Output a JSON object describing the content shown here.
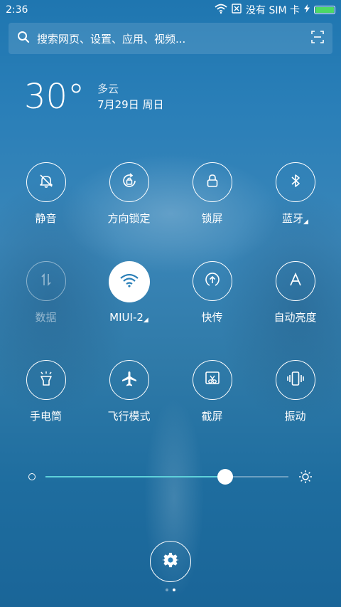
{
  "status_bar": {
    "time": "2:36",
    "carrier": "没有 SIM 卡",
    "battery_level": 1.0,
    "battery_color": "#4cd964"
  },
  "search": {
    "placeholder": "搜索网页、设置、应用、视频...",
    "icon": "search-icon",
    "scan_icon": "scan-icon"
  },
  "weather": {
    "temperature": "30°",
    "condition": "多云",
    "date": "7月29日 周日"
  },
  "toggles": [
    {
      "label": "静音",
      "icon": "bell-off-icon",
      "state": "off"
    },
    {
      "label": "方向锁定",
      "icon": "rotation-lock-icon",
      "state": "off"
    },
    {
      "label": "锁屏",
      "icon": "lock-icon",
      "state": "off"
    },
    {
      "label": "蓝牙",
      "icon": "bluetooth-icon",
      "state": "off",
      "has_menu": true
    },
    {
      "label": "数据",
      "icon": "data-arrows-icon",
      "state": "disabled"
    },
    {
      "label": "MIUI-2",
      "icon": "wifi-icon",
      "state": "on",
      "has_menu": true
    },
    {
      "label": "快传",
      "icon": "upload-icon",
      "state": "off"
    },
    {
      "label": "自动亮度",
      "icon": "auto-brightness-icon",
      "state": "off"
    },
    {
      "label": "手电筒",
      "icon": "flashlight-icon",
      "state": "off"
    },
    {
      "label": "飞行模式",
      "icon": "airplane-icon",
      "state": "off"
    },
    {
      "label": "截屏",
      "icon": "screenshot-icon",
      "state": "off"
    },
    {
      "label": "振动",
      "icon": "vibrate-icon",
      "state": "off"
    }
  ],
  "brightness": {
    "level": 0.74,
    "accent": "#5ed1d9"
  },
  "settings": {
    "icon": "gear-icon"
  },
  "pager": {
    "pages": 2,
    "current": 2
  }
}
